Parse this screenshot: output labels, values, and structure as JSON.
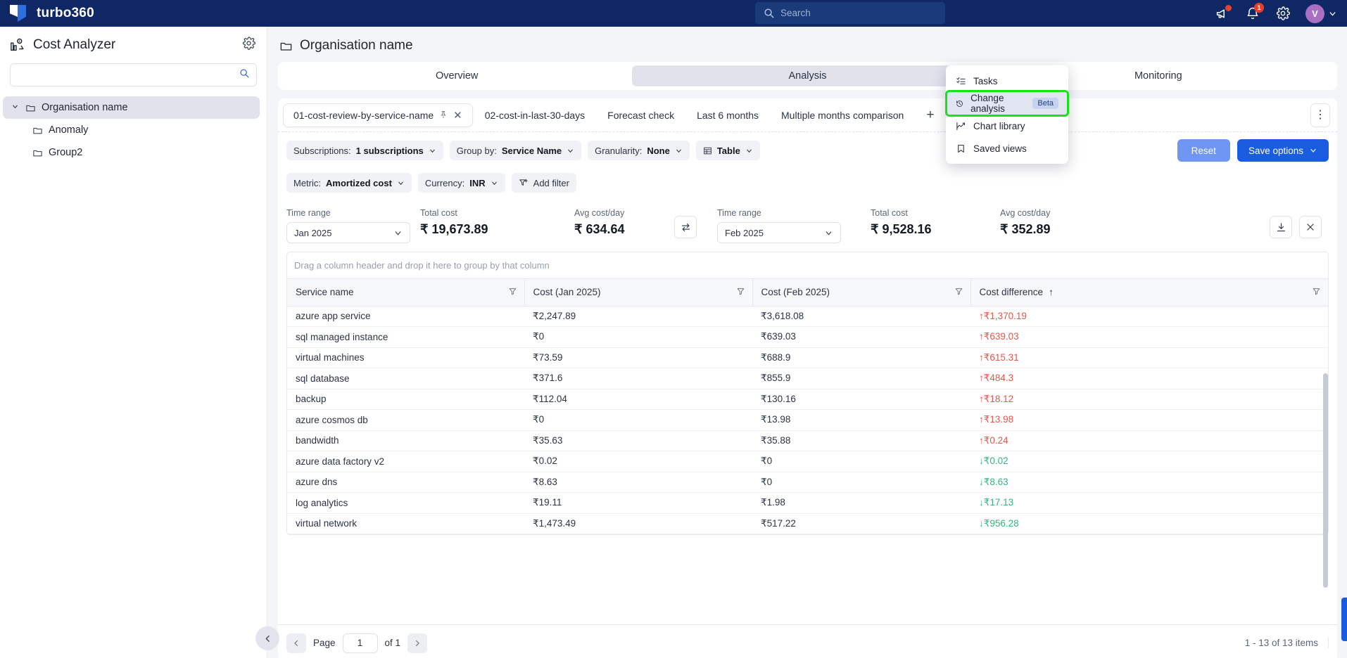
{
  "topbar": {
    "brand": "turbo360",
    "search_placeholder": "Search",
    "announce_icon": "megaphone-icon",
    "bell_badge": "1",
    "avatar_initial": "V"
  },
  "sidebar": {
    "title": "Cost Analyzer",
    "search_value": "",
    "search_placeholder": "",
    "tree": [
      {
        "label": "Organisation name",
        "level": 0,
        "expanded": true,
        "selected": true
      },
      {
        "label": "Anomaly",
        "level": 1,
        "expanded": false,
        "selected": false
      },
      {
        "label": "Group2",
        "level": 1,
        "expanded": false,
        "selected": false
      }
    ]
  },
  "header": {
    "title": "Organisation name"
  },
  "tabs": [
    {
      "label": "Overview",
      "active": false
    },
    {
      "label": "Analysis",
      "active": true
    },
    {
      "label": "Monitoring",
      "active": false
    }
  ],
  "subtabs": [
    {
      "label": "01-cost-review-by-service-name",
      "active": true,
      "pinned": true,
      "closable": true
    },
    {
      "label": "02-cost-in-last-30-days",
      "active": false
    },
    {
      "label": "Forecast check",
      "active": false
    },
    {
      "label": "Last 6 months",
      "active": false
    },
    {
      "label": "Multiple months comparison",
      "active": false
    }
  ],
  "add_tab_label": "+",
  "chips": [
    {
      "key": "Subscriptions:",
      "value": "1 subscriptions",
      "caret": true
    },
    {
      "key": "Group by:",
      "value": "Service Name",
      "caret": true
    },
    {
      "key": "Granularity:",
      "value": "None",
      "caret": true
    },
    {
      "key": "",
      "value": "Table",
      "caret": true,
      "icon": "table-icon"
    },
    {
      "key": "Metric:",
      "value": "Amortized cost",
      "caret": true
    },
    {
      "key": "Currency:",
      "value": "INR",
      "caret": true
    },
    {
      "key": "",
      "value": "Add filter",
      "caret": false,
      "icon": "filter-plus-icon"
    }
  ],
  "action_buttons": [
    {
      "label": "Reset",
      "style": "soft"
    },
    {
      "label": "Save options",
      "style": "primary",
      "caret": true
    }
  ],
  "summary": {
    "left": {
      "time_range_label": "Time range",
      "time_range_value": "Jan 2025",
      "total_cost_label": "Total cost",
      "total_cost_value": "₹ 19,673.89",
      "avg_label": "Avg cost/day",
      "avg_value": "₹ 634.64"
    },
    "right": {
      "time_range_label": "Time range",
      "time_range_value": "Feb 2025",
      "total_cost_label": "Total cost",
      "total_cost_value": "₹ 9,528.16",
      "avg_label": "Avg cost/day",
      "avg_value": "₹ 352.89"
    },
    "swap_icon": "swap-horizontal-icon",
    "download_icon": "download-icon",
    "close_icon": "close-icon"
  },
  "table": {
    "group_hint": "Drag a column header and drop it here to group by that column",
    "columns": [
      {
        "label": "Service name",
        "sort": ""
      },
      {
        "label": "Cost (Jan 2025)",
        "sort": ""
      },
      {
        "label": "Cost (Feb 2025)",
        "sort": ""
      },
      {
        "label": "Cost difference",
        "sort": "↑"
      }
    ],
    "rows": [
      {
        "service": "azure app service",
        "jan": "₹2,247.89",
        "feb": "₹3,618.08",
        "diff": "₹1,370.19",
        "dir": "up"
      },
      {
        "service": "sql managed instance",
        "jan": "₹0",
        "feb": "₹639.03",
        "diff": "₹639.03",
        "dir": "up"
      },
      {
        "service": "virtual machines",
        "jan": "₹73.59",
        "feb": "₹688.9",
        "diff": "₹615.31",
        "dir": "up"
      },
      {
        "service": "sql database",
        "jan": "₹371.6",
        "feb": "₹855.9",
        "diff": "₹484.3",
        "dir": "up"
      },
      {
        "service": "backup",
        "jan": "₹112.04",
        "feb": "₹130.16",
        "diff": "₹18.12",
        "dir": "up"
      },
      {
        "service": "azure cosmos db",
        "jan": "₹0",
        "feb": "₹13.98",
        "diff": "₹13.98",
        "dir": "up"
      },
      {
        "service": "bandwidth",
        "jan": "₹35.63",
        "feb": "₹35.88",
        "diff": "₹0.24",
        "dir": "up"
      },
      {
        "service": "azure data factory v2",
        "jan": "₹0.02",
        "feb": "₹0",
        "diff": "₹0.02",
        "dir": "down"
      },
      {
        "service": "azure dns",
        "jan": "₹8.63",
        "feb": "₹0",
        "diff": "₹8.63",
        "dir": "down"
      },
      {
        "service": "log analytics",
        "jan": "₹19.11",
        "feb": "₹1.98",
        "diff": "₹17.13",
        "dir": "down"
      },
      {
        "service": "virtual network",
        "jan": "₹1,473.49",
        "feb": "₹517.22",
        "diff": "₹956.28",
        "dir": "down"
      }
    ]
  },
  "pager": {
    "page_label": "Page",
    "page_value": "1",
    "of_label": "of 1",
    "items_label": "1 - 13 of 13 items"
  },
  "menu": {
    "items": [
      {
        "label": "Tasks",
        "icon": "tasks-icon",
        "badge": "",
        "highlight": false
      },
      {
        "label": "Change analysis",
        "icon": "history-icon",
        "badge": "Beta",
        "highlight": true
      },
      {
        "label": "Chart library",
        "icon": "chart-line-icon",
        "badge": "",
        "highlight": false
      },
      {
        "label": "Saved views",
        "icon": "bookmark-icon",
        "badge": "",
        "highlight": false
      }
    ]
  },
  "colors": {
    "brand_navy": "#0f2765",
    "accent_blue": "#1a5ce0",
    "up_red": "#e2574c",
    "down_green": "#35b37e",
    "highlight_green": "#1ae11a"
  }
}
